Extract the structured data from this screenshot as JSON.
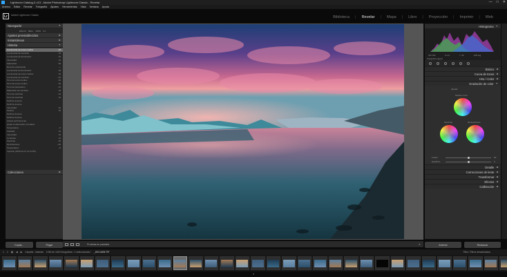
{
  "window": {
    "title": "Lightroom Catalog-2-v13 - Adobe Photoshop Lightroom Classic - Revelar",
    "controls": [
      "—",
      "□",
      "✕"
    ]
  },
  "menu": [
    "Archivo",
    "Editar",
    "Revelar",
    "Fotografía",
    "Ajustes",
    "Herramientas",
    "Vista",
    "Ventana",
    "Ayuda"
  ],
  "identity": {
    "logo": "Lr",
    "catalog": "Adobe Lightroom Classic"
  },
  "modules": {
    "items": [
      "Biblioteca",
      "Revelar",
      "Mapa",
      "Libro",
      "Proyección",
      "Imprimir",
      "Web"
    ],
    "active": "Revelar"
  },
  "left_panel": {
    "navigator": {
      "label": "Navegador",
      "zoom_options": [
        "ENCAJ",
        "RELL",
        "100%",
        "4:1"
      ]
    },
    "presets": {
      "label": "Ajustes preestablecidos"
    },
    "snapshots": {
      "label": "Instantáneas"
    },
    "history": {
      "label": "Historia",
      "items": [
        {
          "label": "Luminancia de tonos medios",
          "v1": "40",
          "v2": "20"
        },
        {
          "label": "Luminancia de sombras",
          "v1": "",
          "v2": "15"
        },
        {
          "label": "Luminancia de iluminación",
          "v1": "",
          "v2": "10"
        },
        {
          "label": "Intensidad",
          "v1": "",
          "v2": "12"
        },
        {
          "label": "Saturación",
          "v1": "",
          "v2": "30"
        },
        {
          "label": "Recorte enderezado",
          "v1": "",
          "v2": "—"
        },
        {
          "label": "Luminancia de iluminación",
          "v1": "",
          "v2": "18"
        },
        {
          "label": "Luminancia de tonos medios",
          "v1": "",
          "v2": "10"
        },
        {
          "label": "Luminancia de sombras",
          "v1": "",
          "v2": "−15"
        },
        {
          "label": "Tono de tonos medios",
          "v1": "",
          "v2": "20"
        },
        {
          "label": "Tono de tonos medios",
          "v1": "",
          "v2": "35"
        },
        {
          "label": "Tono de iluminación",
          "v1": "",
          "v2": "22"
        },
        {
          "label": "Saturación de sombras",
          "v1": "",
          "v2": "18"
        },
        {
          "label": "Tono de sombras",
          "v1": "",
          "v2": "24"
        },
        {
          "label": "Tono de sombras",
          "v1": "",
          "v2": "10"
        },
        {
          "label": "Perfil de la lente",
          "v1": "",
          "v2": ""
        },
        {
          "label": "Perfil de la lente",
          "v1": "",
          "v2": ""
        },
        {
          "label": "Intensidad",
          "v1": "",
          "v2": "20"
        },
        {
          "label": "Textura",
          "v1": "",
          "v2": "15"
        },
        {
          "label": "Perfil de la lente",
          "v1": "",
          "v2": ""
        },
        {
          "label": "Perfil de la lente",
          "v1": "",
          "v2": ""
        },
        {
          "label": "Activar perfil de lente",
          "v1": "",
          "v2": ""
        },
        {
          "label": "Quitar la aberración cromática",
          "v1": "",
          "v2": ""
        },
        {
          "label": "Temperatura",
          "v1": "",
          "v2": "−5"
        },
        {
          "label": "Claridad",
          "v1": "",
          "v2": "10"
        },
        {
          "label": "Intensidad",
          "v1": "",
          "v2": "15"
        },
        {
          "label": "Contraste",
          "v1": "",
          "v2": "12"
        },
        {
          "label": "Sombras",
          "v1": "",
          "v2": "40"
        },
        {
          "label": "Iluminaciones",
          "v1": "",
          "v2": "−30"
        },
        {
          "label": "Temperatura",
          "v1": "",
          "v2": "−8"
        },
        {
          "label": "Importar (2020-10-27 21:24:59)",
          "v1": "",
          "v2": ""
        }
      ]
    },
    "collections": {
      "label": "Colecciones"
    },
    "buttons": {
      "copy": "Copiar...",
      "paste": "Pegar"
    }
  },
  "toolbar": {
    "soft_proof": "Pruebas en pantalla"
  },
  "right_panel": {
    "histogram": {
      "label": "Histograma",
      "values": [
        "ISO 100",
        "9 mm",
        "f / 16",
        "1/30 seg"
      ],
      "original": "Fotografía original"
    },
    "sections": [
      "Básico",
      "Curva de tonos",
      "HSL / Color"
    ],
    "color_grading": {
      "label": "Gradación de color",
      "adjust": "Ajustar:",
      "midtones": "Medios tonos",
      "shadows": "Sombras",
      "highlights": "Iluminaciones",
      "blending": "Fusión",
      "balance": "Equilibrio",
      "blending_value": "50",
      "balance_value": "0"
    },
    "lower_sections": [
      "Detalle",
      "Correcciones de lente",
      "Transformar",
      "Efectos",
      "Calibración"
    ],
    "buttons": {
      "previous": "Anterior",
      "reset": "Restaurar"
    }
  },
  "filmbar": {
    "items": [
      "1",
      "2"
    ],
    "source": "Carpeta : Islandia",
    "count": "1050 de 1620 fotografías / 1 seleccionada /",
    "filename": "_DSC4405.TIF",
    "filter": "Filtro:",
    "filter_value": "Filtros desactivados"
  },
  "filmstrip_count": 34,
  "colors": {
    "accent": "#e8e8e8",
    "panel": "#2e2e2e",
    "selection": "#6a6a6a"
  }
}
